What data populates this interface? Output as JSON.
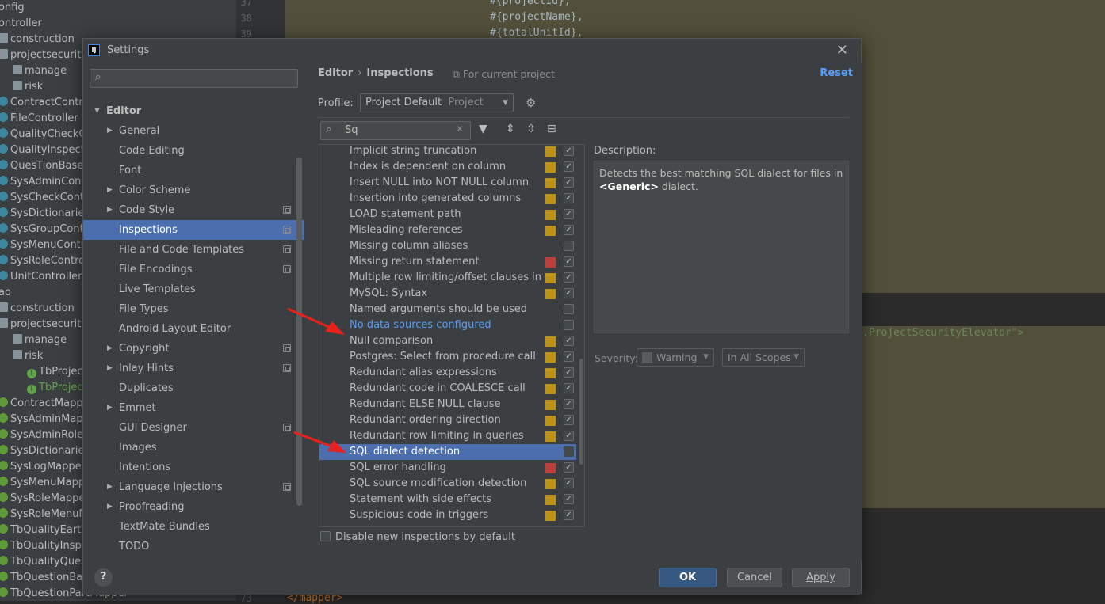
{
  "background": {
    "tree_items": [
      {
        "text": "onfig",
        "icon": "none",
        "indent": 0
      },
      {
        "text": "ontroller",
        "icon": "none",
        "indent": 0
      },
      {
        "text": "construction",
        "icon": "folder",
        "indent": 0
      },
      {
        "text": "projectsecurity",
        "icon": "folder",
        "indent": 0
      },
      {
        "text": "manage",
        "icon": "folder",
        "indent": 1
      },
      {
        "text": "risk",
        "icon": "folder",
        "indent": 1
      },
      {
        "text": "ContractController",
        "icon": "class",
        "indent": 0
      },
      {
        "text": "FileController",
        "icon": "class",
        "indent": 0
      },
      {
        "text": "QualityCheckController",
        "icon": "class",
        "indent": 0
      },
      {
        "text": "QualityInspectController",
        "icon": "class",
        "indent": 0
      },
      {
        "text": "QuesTionBaseController",
        "icon": "class",
        "indent": 0
      },
      {
        "text": "SysAdminController",
        "icon": "class",
        "indent": 0
      },
      {
        "text": "SysCheckController",
        "icon": "class",
        "indent": 0
      },
      {
        "text": "SysDictionariesController",
        "icon": "class",
        "indent": 0
      },
      {
        "text": "SysGroupController",
        "icon": "class",
        "indent": 0
      },
      {
        "text": "SysMenuController",
        "icon": "class",
        "indent": 0
      },
      {
        "text": "SysRoleController",
        "icon": "class",
        "indent": 0
      },
      {
        "text": "UnitController",
        "icon": "class",
        "indent": 0
      },
      {
        "text": "ao",
        "icon": "none",
        "indent": 0
      },
      {
        "text": "construction",
        "icon": "folder",
        "indent": 0
      },
      {
        "text": "projectsecurity",
        "icon": "folder",
        "indent": 0
      },
      {
        "text": "manage",
        "icon": "folder",
        "indent": 1
      },
      {
        "text": "risk",
        "icon": "folder",
        "indent": 1
      },
      {
        "text": "TbProjectSecurity",
        "icon": "iface",
        "indent": 2
      },
      {
        "text": "TbProjectSecurityElevator",
        "icon": "iface",
        "indent": 2,
        "active": true
      },
      {
        "text": "ContractMapper",
        "icon": "mapper",
        "indent": 0
      },
      {
        "text": "SysAdminMapper",
        "icon": "mapper",
        "indent": 0
      },
      {
        "text": "SysAdminRoleMapper",
        "icon": "mapper",
        "indent": 0
      },
      {
        "text": "SysDictionariesMapper",
        "icon": "mapper",
        "indent": 0
      },
      {
        "text": "SysLogMapper",
        "icon": "mapper",
        "indent": 0
      },
      {
        "text": "SysMenuMapper",
        "icon": "mapper",
        "indent": 0
      },
      {
        "text": "SysRoleMapper",
        "icon": "mapper",
        "indent": 0
      },
      {
        "text": "SysRoleMenuMapper",
        "icon": "mapper",
        "indent": 0
      },
      {
        "text": "TbQualityEarthMapper",
        "icon": "mapper",
        "indent": 0
      },
      {
        "text": "TbQualityInspectMapper",
        "icon": "mapper",
        "indent": 0
      },
      {
        "text": "TbQualityQuestionMapper",
        "icon": "mapper",
        "indent": 0
      },
      {
        "text": "TbQuestionBaseMapper",
        "icon": "mapper",
        "indent": 0
      },
      {
        "text": "TbQuestionPartMapper",
        "icon": "mapper",
        "indent": 0
      }
    ],
    "gutter_numbers": [
      "37",
      "38",
      "39",
      "73"
    ],
    "code_lines": [
      "#{projectId},",
      "#{projectName},",
      "#{totalUnitId},"
    ],
    "code_right": ".ProjectSecurityElevator\">",
    "code_bottom": "</mapper>"
  },
  "dialog": {
    "title": "Settings",
    "close_icon": "close-icon",
    "left": {
      "search_placeholder": "",
      "nav": [
        {
          "label": "Editor",
          "level": 0,
          "expanded": true,
          "bold": true
        },
        {
          "label": "General",
          "level": 1,
          "arrow": true
        },
        {
          "label": "Code Editing",
          "level": 1
        },
        {
          "label": "Font",
          "level": 1
        },
        {
          "label": "Color Scheme",
          "level": 1,
          "arrow": true
        },
        {
          "label": "Code Style",
          "level": 1,
          "arrow": true,
          "copy": true
        },
        {
          "label": "Inspections",
          "level": 1,
          "copy": true,
          "selected": true
        },
        {
          "label": "File and Code Templates",
          "level": 1,
          "copy": true
        },
        {
          "label": "File Encodings",
          "level": 1,
          "copy": true
        },
        {
          "label": "Live Templates",
          "level": 1
        },
        {
          "label": "File Types",
          "level": 1
        },
        {
          "label": "Android Layout Editor",
          "level": 1
        },
        {
          "label": "Copyright",
          "level": 1,
          "arrow": true,
          "copy": true
        },
        {
          "label": "Inlay Hints",
          "level": 1,
          "arrow": true,
          "copy": true
        },
        {
          "label": "Duplicates",
          "level": 1
        },
        {
          "label": "Emmet",
          "level": 1,
          "arrow": true
        },
        {
          "label": "GUI Designer",
          "level": 1,
          "copy": true
        },
        {
          "label": "Images",
          "level": 1
        },
        {
          "label": "Intentions",
          "level": 1
        },
        {
          "label": "Language Injections",
          "level": 1,
          "arrow": true,
          "copy": true
        },
        {
          "label": "Proofreading",
          "level": 1,
          "arrow": true
        },
        {
          "label": "TextMate Bundles",
          "level": 1
        },
        {
          "label": "TODO",
          "level": 1
        }
      ]
    },
    "right": {
      "breadcrumb": [
        "Editor",
        "Inspections"
      ],
      "breadcrumb_sep": "›",
      "scope_note": "For current project",
      "reset_label": "Reset",
      "profile_label": "Profile:",
      "profile_value": "Project Default",
      "profile_suffix": "Project",
      "filter_value": "Sq",
      "inspections": [
        {
          "label": "Implicit string truncation",
          "severity": "warning",
          "checked": true
        },
        {
          "label": "Index is dependent on column",
          "severity": "warning",
          "checked": true
        },
        {
          "label": "Insert NULL into NOT NULL column",
          "severity": "warning",
          "checked": true
        },
        {
          "label": "Insertion into generated columns",
          "severity": "warning",
          "checked": true
        },
        {
          "label": "LOAD statement path",
          "severity": "warning",
          "checked": true
        },
        {
          "label": "Misleading references",
          "severity": "warning",
          "checked": true
        },
        {
          "label": "Missing column aliases",
          "severity": "none",
          "checked": false
        },
        {
          "label": "Missing return statement",
          "severity": "error",
          "checked": true
        },
        {
          "label": "Multiple row limiting/offset clauses in queries",
          "severity": "warning",
          "checked": true
        },
        {
          "label": "MySQL: Syntax",
          "severity": "warning",
          "checked": true
        },
        {
          "label": "Named arguments should be used",
          "severity": "none",
          "checked": false
        },
        {
          "label": "No data sources configured",
          "severity": "none",
          "checked": false,
          "link": true
        },
        {
          "label": "Null comparison",
          "severity": "warning",
          "checked": true
        },
        {
          "label": "Postgres: Select from procedure call",
          "severity": "warning",
          "checked": true
        },
        {
          "label": "Redundant alias expressions",
          "severity": "warning",
          "checked": true
        },
        {
          "label": "Redundant code in COALESCE call",
          "severity": "warning",
          "checked": true
        },
        {
          "label": "Redundant ELSE NULL clause",
          "severity": "warning",
          "checked": true
        },
        {
          "label": "Redundant ordering direction",
          "severity": "warning",
          "checked": true
        },
        {
          "label": "Redundant row limiting in queries",
          "severity": "warning",
          "checked": true
        },
        {
          "label": "SQL dialect detection",
          "severity": "none",
          "checked": false,
          "selected": true
        },
        {
          "label": "SQL error handling",
          "severity": "error",
          "checked": true
        },
        {
          "label": "SQL source modification detection",
          "severity": "warning",
          "checked": true
        },
        {
          "label": "Statement with side effects",
          "severity": "warning",
          "checked": true
        },
        {
          "label": "Suspicious code in triggers",
          "severity": "warning",
          "checked": true
        }
      ],
      "description_label": "Description:",
      "description_pre": "Detects the best matching SQL dialect for files in ",
      "description_bold": "<Generic>",
      "description_post": " dialect.",
      "severity_label": "Severity:",
      "severity_value": "Warning",
      "scope_value": "In All Scopes",
      "disable_new_label": "Disable new inspections by default"
    },
    "footer": {
      "help_label": "?",
      "ok_label": "OK",
      "cancel_label": "Cancel",
      "apply_label": "Apply"
    }
  },
  "colors": {
    "selection": "#4b6eaf",
    "warning": "#be9117",
    "error": "#bc3f3c",
    "link": "#589df6",
    "annotation_arrow": "#e8201e"
  }
}
